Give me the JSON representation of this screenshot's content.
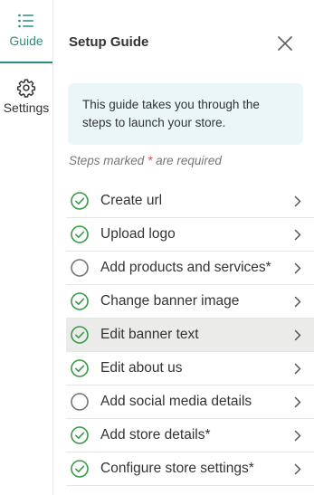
{
  "rail": {
    "tabs": [
      {
        "label": "Guide",
        "icon": "list-icon"
      },
      {
        "label": "Settings",
        "icon": "gear-icon"
      }
    ]
  },
  "panel": {
    "title": "Setup Guide",
    "intro": "This guide takes you through the steps to launch your store.",
    "note_before": "Steps marked ",
    "note_star": "*",
    "note_after": " are required"
  },
  "steps": [
    {
      "label": "Create url",
      "done": true
    },
    {
      "label": "Upload logo",
      "done": true
    },
    {
      "label": "Add products and services*",
      "done": false
    },
    {
      "label": "Change banner image",
      "done": true
    },
    {
      "label": "Edit banner text",
      "done": true,
      "active": true
    },
    {
      "label": "Edit about us",
      "done": true
    },
    {
      "label": "Add social media details",
      "done": false
    },
    {
      "label": "Add store details*",
      "done": true
    },
    {
      "label": "Configure store settings*",
      "done": true
    }
  ],
  "colors": {
    "accent": "#2e8b80",
    "check": "#3a9a4a",
    "pending": "#777777",
    "required": "#e05050",
    "intro_bg": "#eaf6f8",
    "active_row": "#ebebea"
  }
}
